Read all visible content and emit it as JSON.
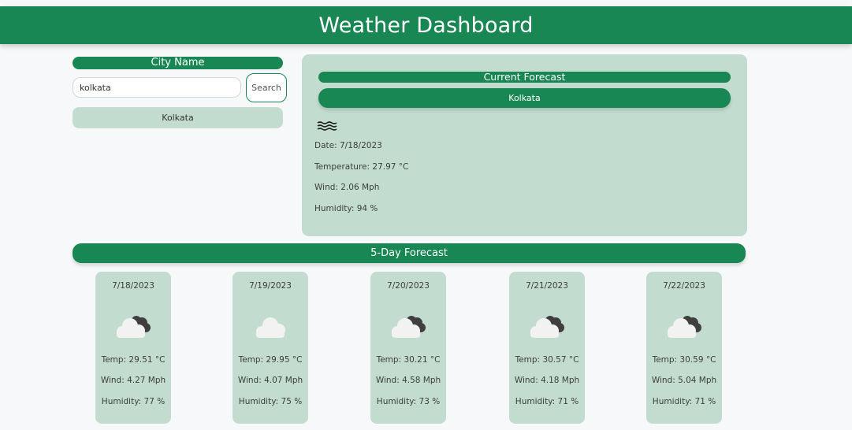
{
  "header": {
    "title": "Weather Dashboard"
  },
  "search": {
    "label": "City Name",
    "input_value": "kolkata",
    "button_label": "Search",
    "history": [
      "Kolkata"
    ]
  },
  "current": {
    "title": "Current Forecast",
    "city": "Kolkata",
    "icon": "wind-waves-icon",
    "date": "Date: 7/18/2023",
    "temp": "Temperature: 27.97 °C",
    "wind": "Wind: 2.06 Mph",
    "humidity": "Humidity: 94 %"
  },
  "forecast": {
    "title": "5-Day Forecast",
    "days": [
      {
        "date": "7/18/2023",
        "icon": "cloud-dark-icon",
        "temp": "Temp: 29.51 °C",
        "wind": "Wind: 4.27 Mph",
        "humidity": "Humidity: 77 %"
      },
      {
        "date": "7/19/2023",
        "icon": "cloud-icon",
        "temp": "Temp: 29.95 °C",
        "wind": "Wind: 4.07 Mph",
        "humidity": "Humidity: 75 %"
      },
      {
        "date": "7/20/2023",
        "icon": "cloud-dark-icon",
        "temp": "Temp: 30.21 °C",
        "wind": "Wind: 4.58 Mph",
        "humidity": "Humidity: 73 %"
      },
      {
        "date": "7/21/2023",
        "icon": "cloud-dark-icon",
        "temp": "Temp: 30.57 °C",
        "wind": "Wind: 4.18 Mph",
        "humidity": "Humidity: 71 %"
      },
      {
        "date": "7/22/2023",
        "icon": "cloud-dark-icon",
        "temp": "Temp: 30.59 °C",
        "wind": "Wind: 5.04 Mph",
        "humidity": "Humidity: 71 %"
      }
    ]
  },
  "colors": {
    "accent": "#198754",
    "panel": "#c2ddd0",
    "background": "#f7f8fa"
  }
}
